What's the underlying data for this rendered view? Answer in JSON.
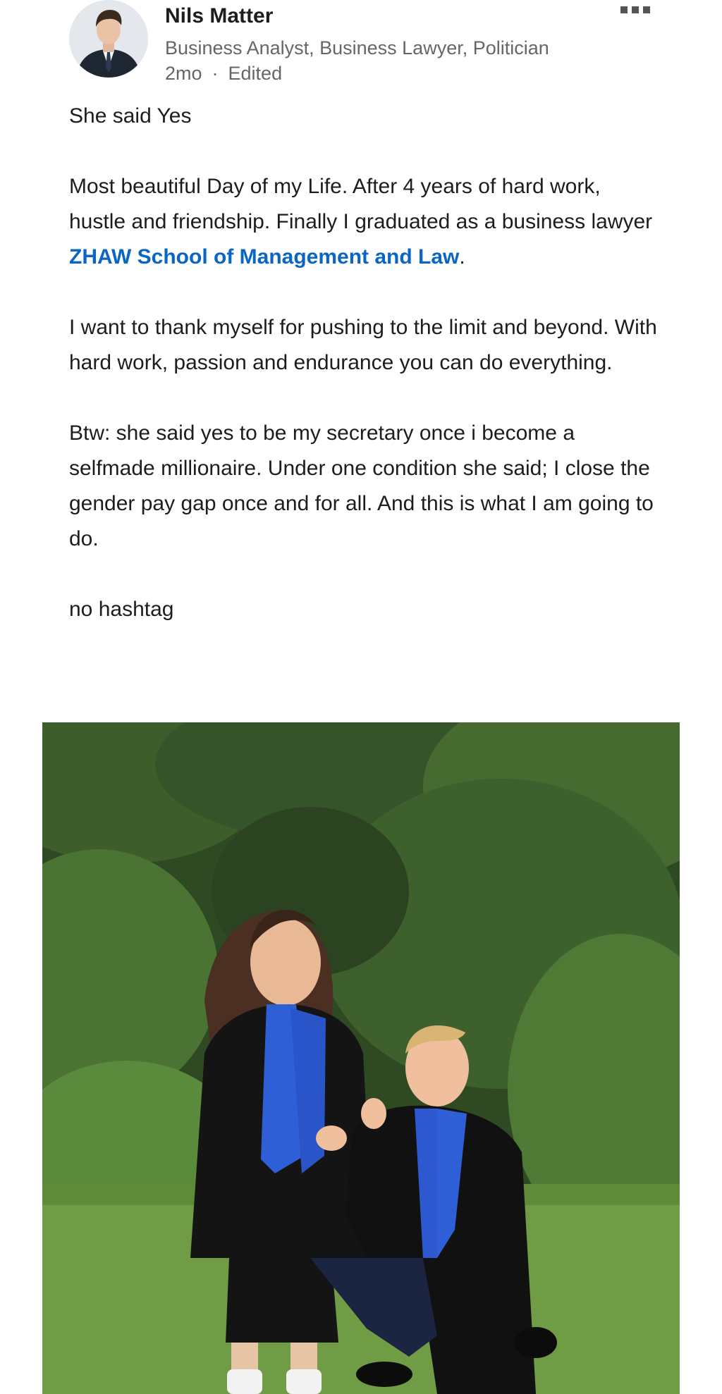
{
  "author": {
    "name": "Nils Matter",
    "headline": "Business Analyst, Business Lawyer, Politician",
    "time": "2mo",
    "separator": "·",
    "edited": "Edited"
  },
  "post": {
    "line1": "She said Yes",
    "para2_before": "Most beautiful Day of my Life. After 4 years of hard work, hustle and friendship. Finally I graduated as a business lawyer ",
    "mention": "ZHAW School of Management and Law",
    "para2_after": ".",
    "para3": "I want to thank myself for pushing to the limit and beyond. With hard work, passion and endurance you can do everything.",
    "para4": "Btw: she said yes to be my secretary once i become a selfmade millionaire. Under one condition she said; I close the gender pay gap once and for all. And this is what I am going to do.",
    "para5": "no hashtag"
  },
  "icons": {
    "more": "more-options-icon"
  },
  "colors": {
    "accent": "#0a66c2",
    "text": "#1d1d1f",
    "secondary": "#666666"
  }
}
